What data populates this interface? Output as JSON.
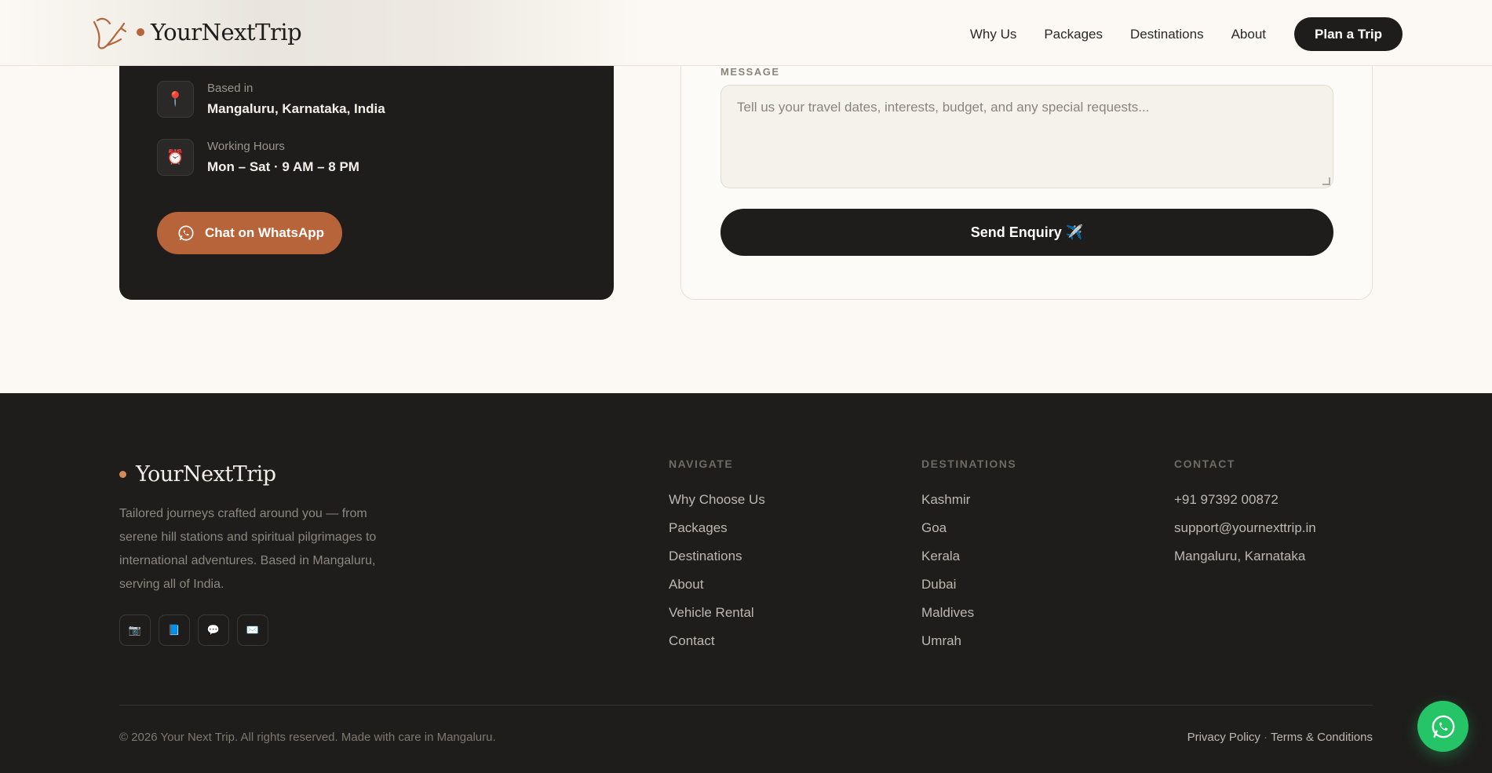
{
  "header": {
    "brand": "YourNextTrip",
    "nav": [
      "Why Us",
      "Packages",
      "Destinations",
      "About"
    ],
    "cta": "Plan a Trip"
  },
  "contact": {
    "location_label": "Based in",
    "location_value": "Mangaluru, Karnataka, India",
    "hours_label": "Working Hours",
    "hours_value": "Mon – Sat · 9 AM – 8 PM",
    "whatsapp_label": "Chat on WhatsApp"
  },
  "form": {
    "message_label": "MESSAGE",
    "message_placeholder": "Tell us your travel dates, interests, budget, and any special requests...",
    "send_label": "Send Enquiry ✈️"
  },
  "footer": {
    "brand": "YourNextTrip",
    "description": "Tailored journeys crafted around you — from serene hill stations and spiritual pilgrimages to international adventures. Based in Mangaluru, serving all of India.",
    "socials": [
      "📷",
      "📘",
      "💬",
      "✉️"
    ],
    "navigate": {
      "title": "NAVIGATE",
      "links": [
        "Why Choose Us",
        "Packages",
        "Destinations",
        "About",
        "Vehicle Rental",
        "Contact"
      ]
    },
    "destinations": {
      "title": "DESTINATIONS",
      "links": [
        "Kashmir",
        "Goa",
        "Kerala",
        "Dubai",
        "Maldives",
        "Umrah"
      ]
    },
    "contact": {
      "title": "CONTACT",
      "links": [
        "+91 97392 00872",
        "support@yournexttrip.in",
        "Mangaluru, Karnataka"
      ]
    },
    "copyright": "© 2026 Your Next Trip. All rights reserved. Made with care in Mangaluru.",
    "privacy": "Privacy Policy",
    "separator": "·",
    "terms": "Terms & Conditions"
  },
  "colors": {
    "accent": "#b8643a",
    "dark": "#1e1d1b",
    "whatsapp": "#25c466"
  }
}
